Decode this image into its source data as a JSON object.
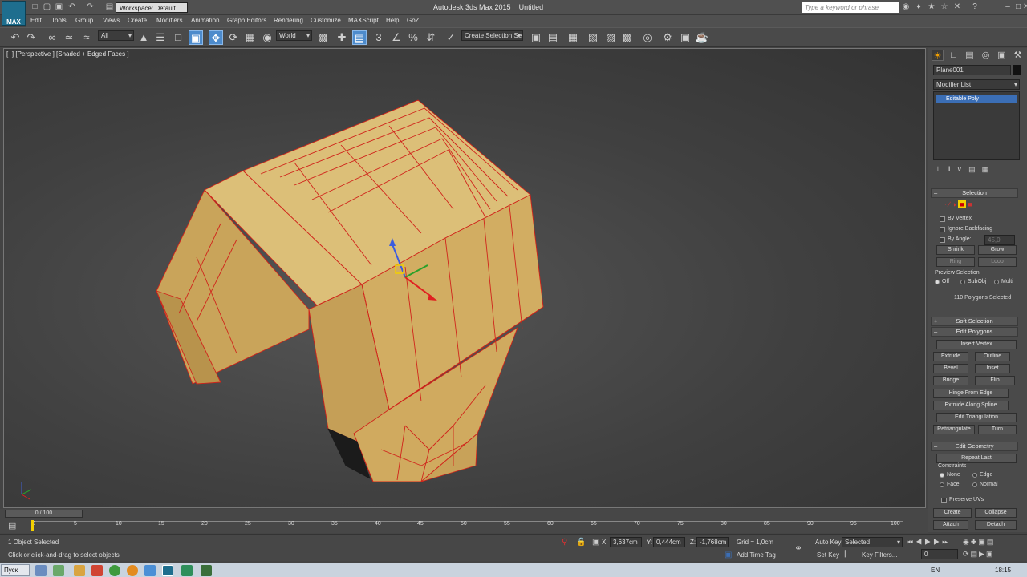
{
  "app": {
    "title": "Autodesk 3ds Max 2015",
    "file": "Untitled",
    "workspace": "Workspace: Default",
    "search_placeholder": "Type a keyword or phrase",
    "logo": "MAX"
  },
  "menu": [
    "Edit",
    "Tools",
    "Group",
    "Views",
    "Create",
    "Modifiers",
    "Animation",
    "Graph Editors",
    "Rendering",
    "Customize",
    "MAXScript",
    "Help",
    "GoZ"
  ],
  "toolbar": {
    "filter": "All",
    "coord": "World",
    "selection_set": "Create Selection Se"
  },
  "viewport": {
    "label": "[+] [Perspective ] [Shaded + Edged Faces ]"
  },
  "command_panel": {
    "object_name": "Plane001",
    "modifier_list": "Modifier List",
    "stack_item": "Editable Poly",
    "selection": {
      "title": "Selection",
      "by_vertex": "By Vertex",
      "ignore_backfacing": "Ignore Backfacing",
      "by_angle": "By Angle:",
      "angle_value": "45,0",
      "shrink": "Shrink",
      "grow": "Grow",
      "ring": "Ring",
      "loop": "Loop",
      "preview_selection": "Preview Selection",
      "preview_off": "Off",
      "preview_subobj": "SubObj",
      "preview_multi": "Multi",
      "status": "110 Polygons Selected"
    },
    "soft_selection": "Soft Selection",
    "edit_polygons": {
      "title": "Edit Polygons",
      "insert_vertex": "Insert Vertex",
      "extrude": "Extrude",
      "outline": "Outline",
      "bevel": "Bevel",
      "inset": "Inset",
      "bridge": "Bridge",
      "flip": "Flip",
      "hinge": "Hinge From Edge",
      "extrude_spline": "Extrude Along Spline",
      "edit_triangulation": "Edit Triangulation",
      "retriangulate": "Retriangulate",
      "turn": "Turn"
    },
    "edit_geometry": {
      "title": "Edit Geometry",
      "repeat_last": "Repeat Last",
      "constraints": "Constraints",
      "none": "None",
      "edge": "Edge",
      "face": "Face",
      "normal": "Normal",
      "preserve_uvs": "Preserve UVs",
      "create": "Create",
      "collapse": "Collapse",
      "attach": "Attach",
      "detach": "Detach"
    }
  },
  "timeline": {
    "frame": "0 / 100",
    "ticks": [
      "0",
      "5",
      "10",
      "15",
      "20",
      "25",
      "30",
      "35",
      "40",
      "45",
      "50",
      "55",
      "60",
      "65",
      "70",
      "75",
      "80",
      "85",
      "90",
      "95",
      "100"
    ]
  },
  "status": {
    "selected": "1 Object Selected",
    "prompt": "Click or click-and-drag to select objects",
    "x_label": "X:",
    "x": "3,637cm",
    "y_label": "Y:",
    "y": "0,444cm",
    "z_label": "Z:",
    "z": "-1,768cm",
    "grid": "Grid = 1,0cm",
    "add_time_tag": "Add Time Tag",
    "auto_key": "Auto Key",
    "auto_key_value": "Selected",
    "set_key": "Set Key",
    "key_filters": "Key Filters...",
    "current_frame": "0"
  },
  "taskbar": {
    "start": "Пуск",
    "lang": "EN",
    "clock": "18:15"
  },
  "colors": {
    "poly_fill": "#d6b46b",
    "poly_edge": "#d0241b",
    "selection_blue": "#3b6eb5",
    "active_tab": "#f3a000"
  }
}
